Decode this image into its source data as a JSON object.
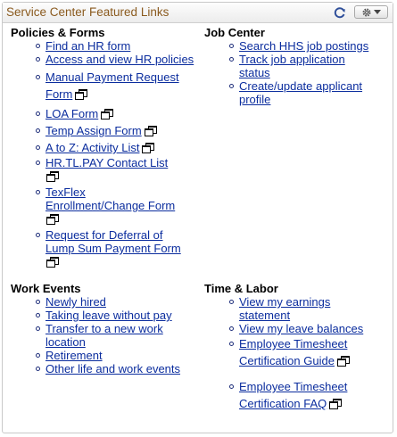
{
  "header": {
    "title": "Service Center Featured Links",
    "refresh_icon": "refresh-icon",
    "actions_icon": "gear-icon"
  },
  "policies": {
    "title": "Policies & Forms",
    "items": [
      "Find an HR form",
      "Access and view HR policies",
      "Manual Payment Request Form",
      "LOA Form",
      "Temp Assign Form",
      "A to Z: Activity List",
      "HR.TL.PAY Contact List",
      "TexFlex Enrollment/Change Form",
      "Request for Deferral of Lump Sum Payment Form"
    ]
  },
  "job_center": {
    "title": "Job Center",
    "items": [
      "Search HHS job postings",
      "Track job application status",
      "Create/update applicant profile"
    ]
  },
  "work_events": {
    "title": "Work Events",
    "items": [
      "Newly hired",
      "Taking leave without pay",
      "Transfer to a new work location",
      "Retirement",
      "Other life and work events"
    ]
  },
  "time_labor": {
    "title": "Time & Labor",
    "items": [
      "View my earnings statement",
      "View my leave balances",
      "Employee Timesheet Certification Guide",
      "Employee Timesheet Certification FAQ"
    ]
  },
  "colors": {
    "title": "#8a5a1e",
    "link": "#0b2d9e"
  }
}
